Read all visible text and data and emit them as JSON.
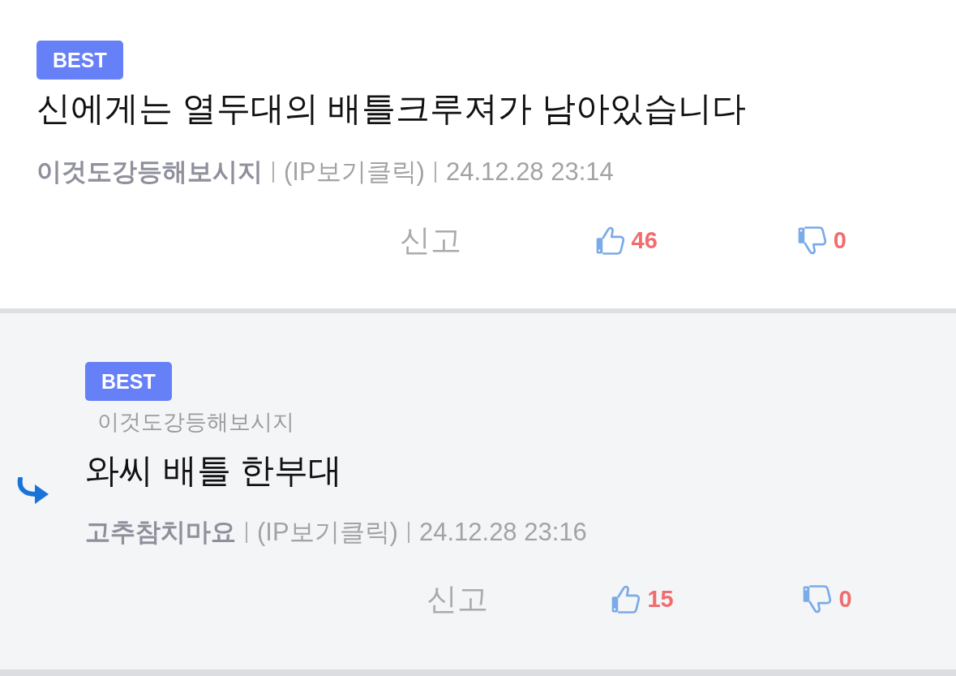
{
  "comments": [
    {
      "kind": "comment",
      "badge": "BEST",
      "text": "신에게는 열두대의 배틀크루져가 남아있습니다",
      "author": "이것도강등해보시지",
      "ip_link": "(IP보기클릭)",
      "date": "24.12.28 23:14",
      "report": "신고",
      "likes": "46",
      "dislikes": "0"
    },
    {
      "kind": "reply",
      "badge": "BEST",
      "reply_to": "이것도강등해보시지",
      "text": "와씨 배틀 한부대",
      "author": "고추참치마요",
      "ip_link": "(IP보기클릭)",
      "date": "24.12.28 23:16",
      "report": "신고",
      "likes": "15",
      "dislikes": "0"
    }
  ]
}
